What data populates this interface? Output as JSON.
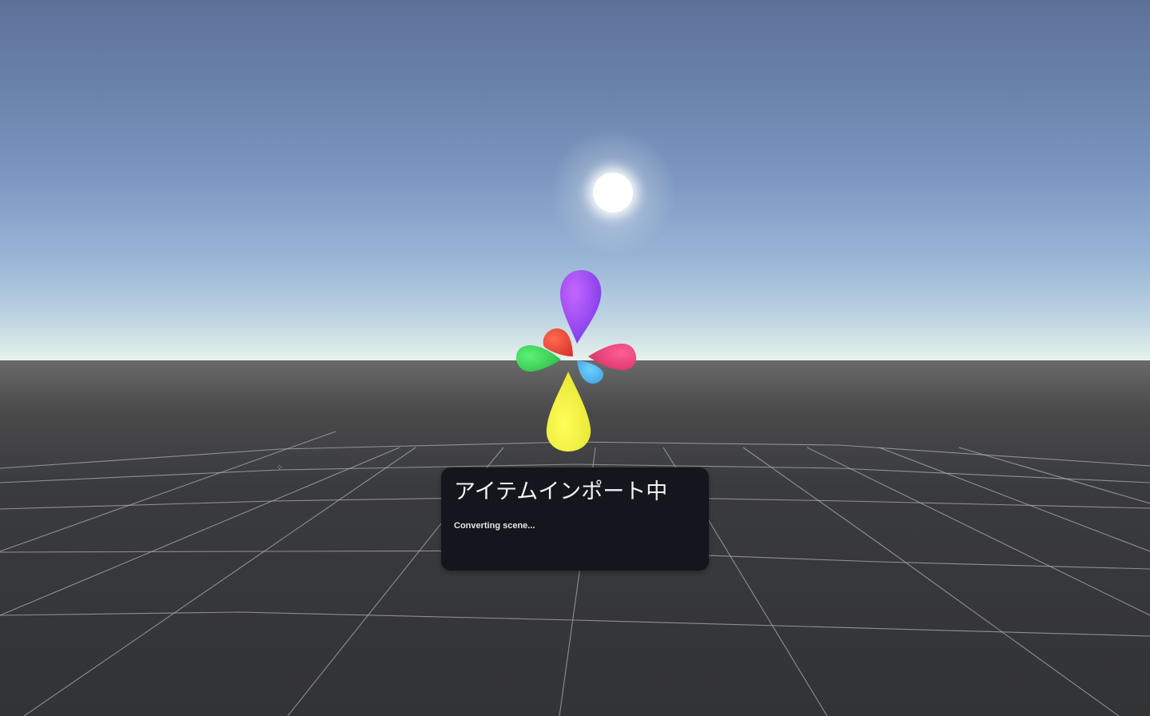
{
  "scene": {
    "sky_top_color": "#5e7198",
    "sky_horizon_color": "#e6f2ec",
    "ground_color": "#3a3b3d",
    "grid_line_color": "#a9acaf",
    "sun_color": "#ffffff"
  },
  "loader": {
    "petal_colors": {
      "top": "#a052f5",
      "right": "#f2467d",
      "bottom": "#f4f53a",
      "left": "#3ee55c",
      "center_red": "#f24c3e",
      "center_blue": "#4ab4f3"
    }
  },
  "cursor": {
    "icon": "move-cursor-icon",
    "glyph": "⁘"
  },
  "import_panel": {
    "title": "アイテムインポート中",
    "status": "Converting scene..."
  }
}
